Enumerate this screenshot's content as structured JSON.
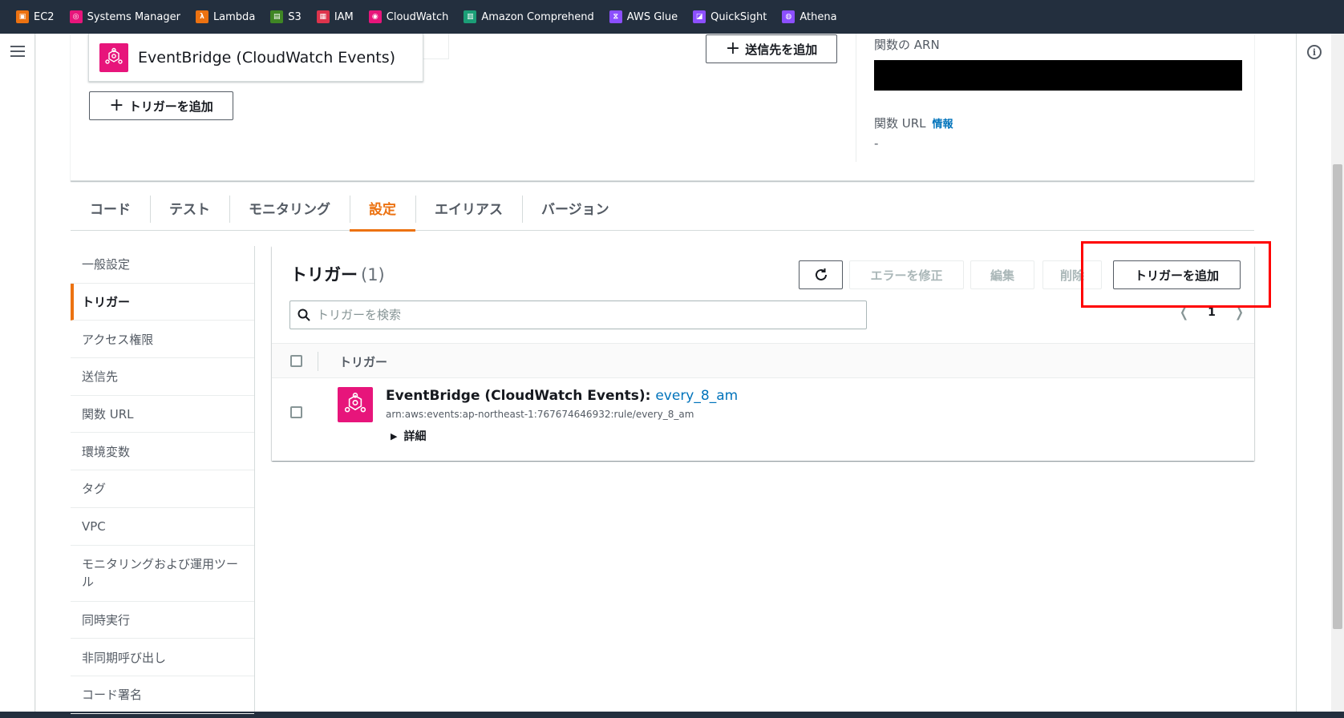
{
  "favorites": [
    {
      "label": "EC2",
      "color": "#ec7211",
      "glyph": "▣"
    },
    {
      "label": "Systems Manager",
      "color": "#e7157b",
      "glyph": "◎"
    },
    {
      "label": "Lambda",
      "color": "#ec7211",
      "glyph": "λ"
    },
    {
      "label": "S3",
      "color": "#3f8624",
      "glyph": "▤"
    },
    {
      "label": "IAM",
      "color": "#dd344c",
      "glyph": "▦"
    },
    {
      "label": "CloudWatch",
      "color": "#e7157b",
      "glyph": "◉"
    },
    {
      "label": "Amazon Comprehend",
      "color": "#1b9e77",
      "glyph": "▥"
    },
    {
      "label": "AWS Glue",
      "color": "#8c4fff",
      "glyph": "⧖"
    },
    {
      "label": "QuickSight",
      "color": "#8c4fff",
      "glyph": "◪"
    },
    {
      "label": "Athena",
      "color": "#8c4fff",
      "glyph": "◍"
    }
  ],
  "overview": {
    "source_name": "EventBridge (CloudWatch Events)",
    "add_trigger_label": "トリガーを追加",
    "add_destination_label": "送信先を追加",
    "arn_label": "関数の ARN",
    "url_label": "関数 URL",
    "url_info_link": "情報",
    "url_value": "-"
  },
  "tabs": [
    "コード",
    "テスト",
    "モニタリング",
    "設定",
    "エイリアス",
    "バージョン"
  ],
  "active_tab": "設定",
  "sidenav": [
    "一般設定",
    "トリガー",
    "アクセス権限",
    "送信先",
    "関数 URL",
    "環境変数",
    "タグ",
    "VPC",
    "モニタリングおよび運用ツール",
    "同時実行",
    "非同期呼び出し",
    "コード署名"
  ],
  "triggers_panel": {
    "title": "トリガー",
    "count": "(1)",
    "fix_errors_label": "エラーを修正",
    "edit_label": "編集",
    "delete_label": "削除",
    "add_trigger_label": "トリガーを追加",
    "search_placeholder": "トリガーを検索",
    "page_number": "1",
    "column_header": "トリガー",
    "rows": [
      {
        "source": "EventBridge (CloudWatch Events):",
        "rule_name": "every_8_am",
        "arn": "arn:aws:events:ap-northeast-1:767674646932:rule/every_8_am",
        "details_label": "詳細"
      }
    ]
  }
}
